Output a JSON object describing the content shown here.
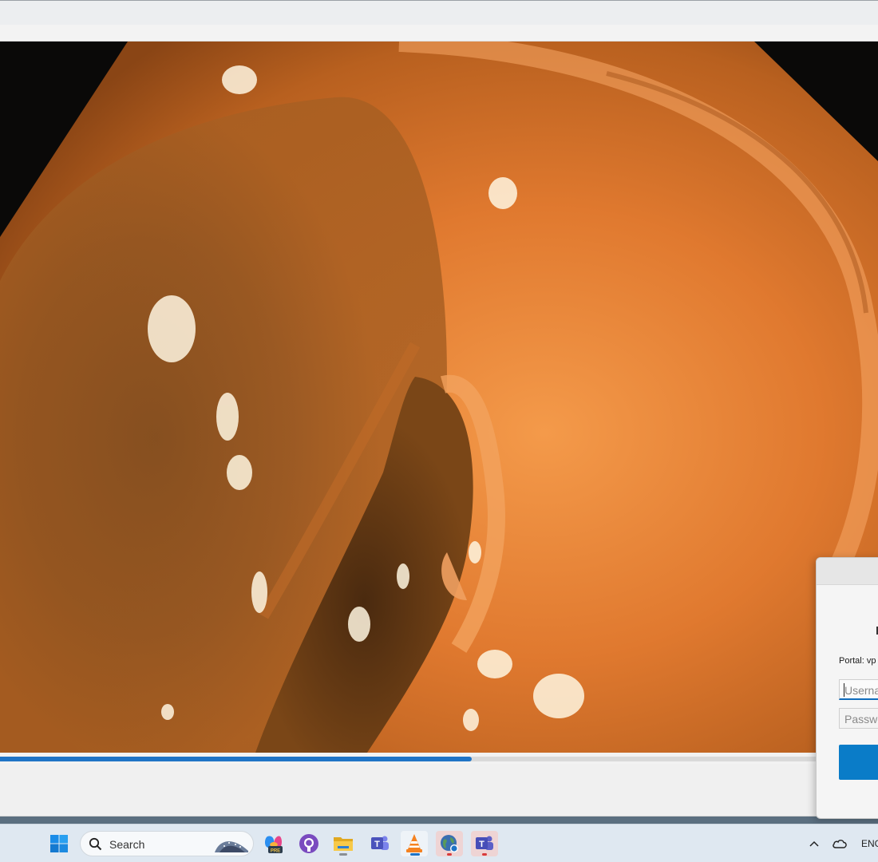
{
  "video": {
    "progress_percent": 53.7
  },
  "dialog": {
    "portal_label": "Portal: vp",
    "username_placeholder": "Userna",
    "password_placeholder": "Passwo"
  },
  "taskbar": {
    "search_placeholder": "Search",
    "tray_language": "ENG",
    "apps": [
      "start-icon",
      "copilot-pre-icon",
      "github-icon",
      "file-explorer-icon",
      "teams-classic-icon",
      "vlc-icon",
      "globe-vpn-icon",
      "teams-icon"
    ]
  }
}
